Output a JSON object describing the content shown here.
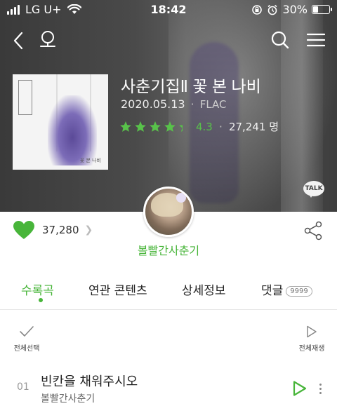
{
  "status_bar": {
    "carrier": "LG U+",
    "time": "18:42",
    "battery": "30%",
    "battery_level": 0.3
  },
  "nav": {
    "back_icon": "back-chevron-icon",
    "logo_glyph": "ഉ",
    "search_icon": "search-icon",
    "menu_icon": "hamburger-menu-icon"
  },
  "album": {
    "title": "사춘기집Ⅱ 꽃 본 나비",
    "release_date": "2020.05.13",
    "format": "FLAC",
    "rating": "4.3",
    "rating_value": 4.3,
    "rating_count": "27,241 명",
    "talk_label": "TALK",
    "cover_tag": "꽃 본 나비"
  },
  "artist": {
    "name": "볼빨간사춘기"
  },
  "likes": {
    "count": "37,280"
  },
  "tabs": [
    {
      "label": "수록곡",
      "active": true
    },
    {
      "label": "연관 콘텐츠",
      "active": false
    },
    {
      "label": "상세정보",
      "active": false
    },
    {
      "label": "댓글",
      "active": false,
      "badge": "9999"
    }
  ],
  "toolbar": {
    "select_all": "전체선택",
    "play_all": "전체재생"
  },
  "tracks": [
    {
      "number": "01",
      "title": "빈칸을 채워주시오",
      "artist": "볼빨간사춘기"
    }
  ],
  "colors": {
    "accent_green": "#48b53a",
    "star_green": "#58c24a",
    "hero_bg": "#4a4a4a"
  }
}
